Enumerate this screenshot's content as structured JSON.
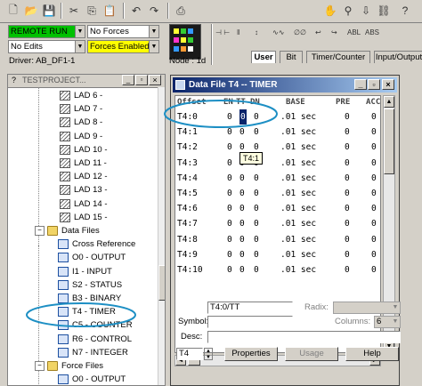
{
  "status": {
    "mode": "REMOTE RUN",
    "edits": "No Edits",
    "driver": "Driver: AB_DF1-1",
    "forces": "No Forces",
    "forces_enabled": "Forces Enabled",
    "node": "Node : 1d"
  },
  "toolbar_icons": [
    "new-file-icon",
    "open-folder-icon",
    "save-icon",
    "cut-icon",
    "copy-icon",
    "paste-icon",
    "undo-icon",
    "redo-icon",
    "print-icon"
  ],
  "instruction_bar": {
    "symbols": [
      "⊣ ⊢",
      "‖",
      "↕",
      "∿∿",
      "∅∅",
      "↩",
      "↪",
      "ABL",
      "ABS"
    ],
    "tabs": [
      "User",
      "Bit",
      "Timer/Counter",
      "Input/Output"
    ]
  },
  "tree": {
    "title": "TESTPROJECT...",
    "items": [
      {
        "label": "LAD 6 -",
        "type": "lad"
      },
      {
        "label": "LAD 7 -",
        "type": "lad"
      },
      {
        "label": "LAD 8 -",
        "type": "lad"
      },
      {
        "label": "LAD 9 -",
        "type": "lad"
      },
      {
        "label": "LAD 10 -",
        "type": "lad"
      },
      {
        "label": "LAD 11 -",
        "type": "lad"
      },
      {
        "label": "LAD 12 -",
        "type": "lad"
      },
      {
        "label": "LAD 13 -",
        "type": "lad"
      },
      {
        "label": "LAD 14 -",
        "type": "lad"
      },
      {
        "label": "LAD 15 -",
        "type": "lad"
      },
      {
        "label": "Data Files",
        "type": "folder"
      },
      {
        "label": "Cross Reference",
        "type": "file"
      },
      {
        "label": "O0 - OUTPUT",
        "type": "file"
      },
      {
        "label": "I1 - INPUT",
        "type": "file"
      },
      {
        "label": "S2 - STATUS",
        "type": "file"
      },
      {
        "label": "B3 - BINARY",
        "type": "file"
      },
      {
        "label": "T4 - TIMER",
        "type": "file"
      },
      {
        "label": "C5 - COUNTER",
        "type": "file"
      },
      {
        "label": "R6 - CONTROL",
        "type": "file"
      },
      {
        "label": "N7 - INTEGER",
        "type": "file"
      },
      {
        "label": "Force Files",
        "type": "folder"
      },
      {
        "label": "O0 - OUTPUT",
        "type": "file"
      }
    ]
  },
  "data_window": {
    "title": "Data File T4  --  TIMER",
    "headers": [
      "Offset",
      "EN",
      "TT",
      "DN",
      "BASE",
      "PRE",
      "ACC"
    ],
    "rows": [
      {
        "offset": "T4:0",
        "en": "0",
        "tt": "0",
        "dn": "0",
        "base": ".01 sec",
        "pre": "0",
        "acc": "0"
      },
      {
        "offset": "T4:1",
        "en": "0",
        "tt": "0",
        "dn": "0",
        "base": ".01 sec",
        "pre": "0",
        "acc": "0"
      },
      {
        "offset": "T4:2",
        "en": "0",
        "tt": "0",
        "dn": "0",
        "base": ".01 sec",
        "pre": "0",
        "acc": "0"
      },
      {
        "offset": "T4:3",
        "en": "0",
        "tt": "0",
        "dn": "0",
        "base": ".01 sec",
        "pre": "0",
        "acc": "0"
      },
      {
        "offset": "T4:4",
        "en": "0",
        "tt": "0",
        "dn": "0",
        "base": ".01 sec",
        "pre": "0",
        "acc": "0"
      },
      {
        "offset": "T4:5",
        "en": "0",
        "tt": "0",
        "dn": "0",
        "base": ".01 sec",
        "pre": "0",
        "acc": "0"
      },
      {
        "offset": "T4:6",
        "en": "0",
        "tt": "0",
        "dn": "0",
        "base": ".01 sec",
        "pre": "0",
        "acc": "0"
      },
      {
        "offset": "T4:7",
        "en": "0",
        "tt": "0",
        "dn": "0",
        "base": ".01 sec",
        "pre": "0",
        "acc": "0"
      },
      {
        "offset": "T4:8",
        "en": "0",
        "tt": "0",
        "dn": "0",
        "base": ".01 sec",
        "pre": "0",
        "acc": "0"
      },
      {
        "offset": "T4:9",
        "en": "0",
        "tt": "0",
        "dn": "0",
        "base": ".01 sec",
        "pre": "0",
        "acc": "0"
      },
      {
        "offset": "T4:10",
        "en": "0",
        "tt": "0",
        "dn": "0",
        "base": ".01 sec",
        "pre": "0",
        "acc": "0"
      }
    ],
    "tooltip": "T4:1",
    "address": "T4:0/TT",
    "radix_label": "Radix:",
    "symbol_label": "Symbol:",
    "columns_label": "Columns:",
    "columns_value": "6",
    "desc_label": "Desc:",
    "file_value": "T4",
    "properties_label": "Properties",
    "usage_label": "Usage",
    "help_label": "Help"
  },
  "colors": {
    "run_green": "#00c000",
    "forces_yellow": "#ffff00",
    "annotation_blue": "#1d8fc4",
    "title_blue": "#0a246a"
  }
}
